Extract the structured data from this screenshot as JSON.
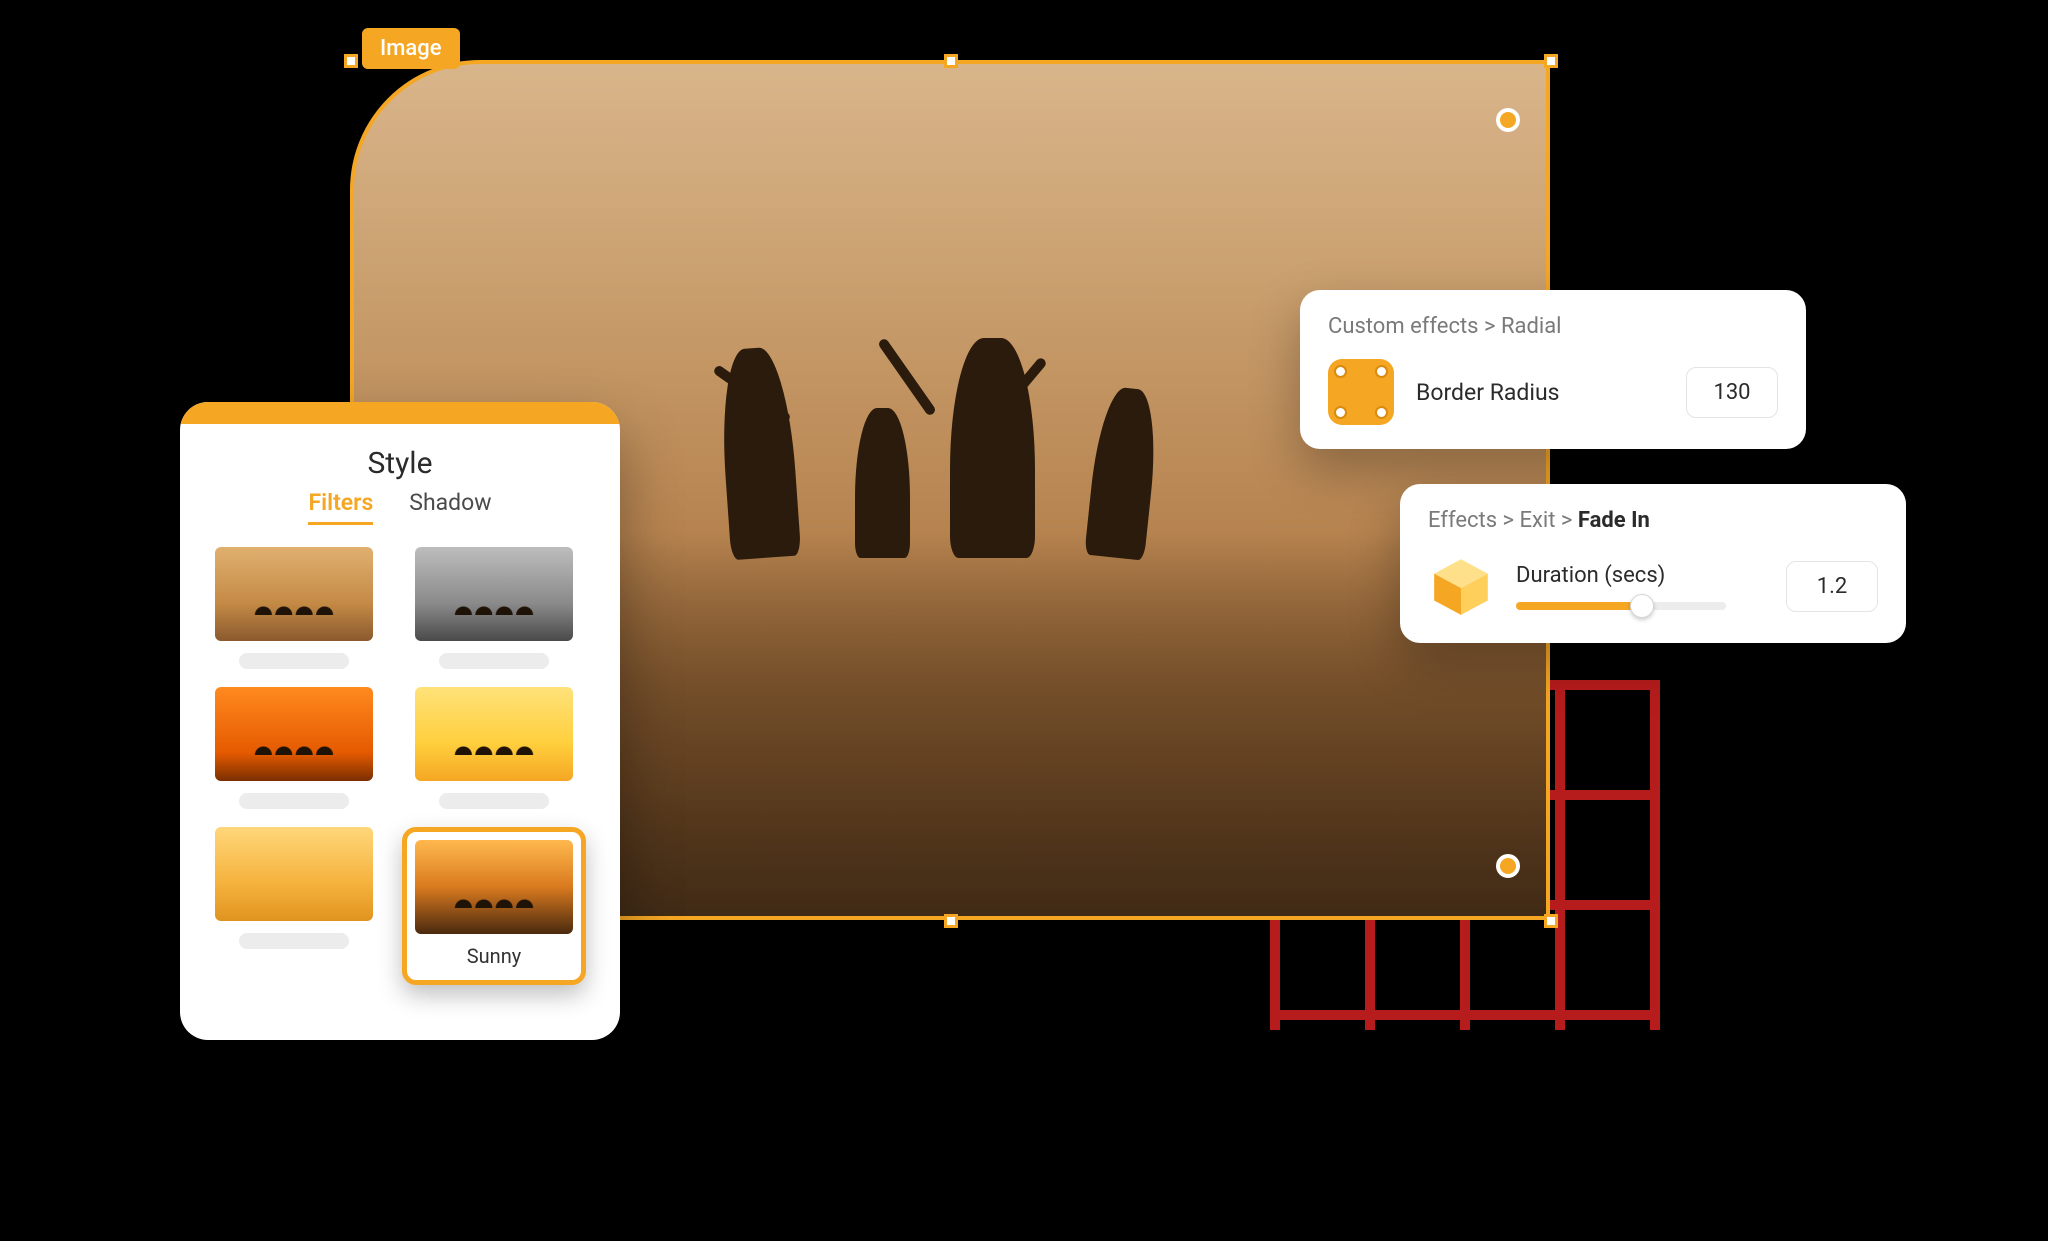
{
  "canvas": {
    "selection_label": "Image"
  },
  "style_panel": {
    "title": "Style",
    "tabs": {
      "filters": "Filters",
      "shadow": "Shadow",
      "active": "filters"
    },
    "selected_filter_label": "Sunny"
  },
  "border_radius_card": {
    "breadcrumb": "Custom effects > Radial",
    "label": "Border Radius",
    "value": "130"
  },
  "duration_card": {
    "breadcrumb_prefix": "Effects > Exit > ",
    "breadcrumb_bold": "Fade In",
    "label": "Duration (secs)",
    "value": "1.2"
  }
}
